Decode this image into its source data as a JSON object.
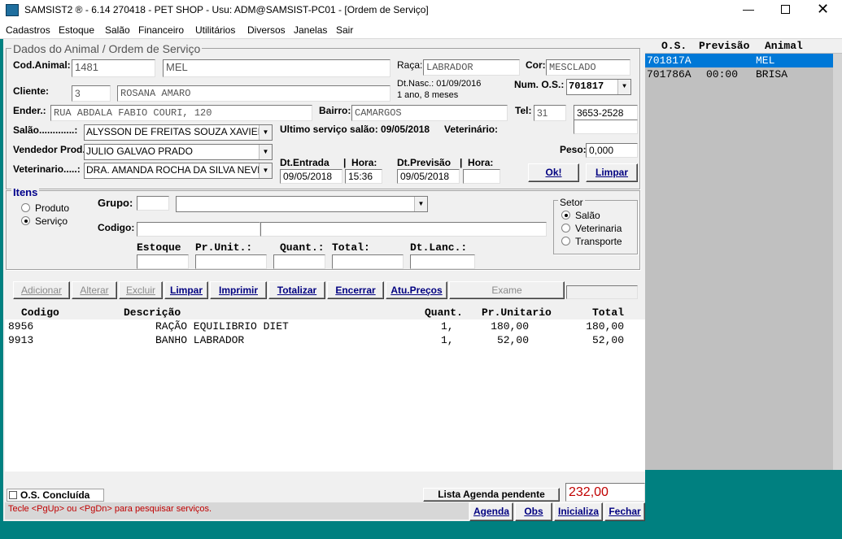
{
  "window": {
    "title": "SAMSIST2 ® - 6.14  270418 - PET SHOP - Usu: ADM@SAMSIST-PC01 - [Ordem de Serviço]"
  },
  "menu": [
    "Cadastros",
    "Estoque",
    "Salão",
    "Financeiro",
    "Utilitários",
    "Diversos",
    "Janelas",
    "Sair"
  ],
  "section_title": "Dados do Animal / Ordem de Serviço",
  "animal": {
    "cod_label": "Cod.Animal:",
    "cod": "1481",
    "nome": "MEL",
    "raca_label": "Raça:",
    "raca": "LABRADOR",
    "cor_label": "Cor:",
    "cor": "MESCLADO",
    "cliente_label": "Cliente:",
    "cliente_cod": "3",
    "cliente_nome": "ROSANA AMARO",
    "dtnasc": "Dt.Nasc.: 01/09/2016",
    "idade": "1 ano,  8 meses",
    "numos_label": "Num. O.S.:",
    "numos": "701817",
    "ender_label": "Ender.:",
    "ender": "RUA ABDALA FABIO COURI, 120",
    "bairro_label": "Bairro:",
    "bairro": "CAMARGOS",
    "tel_label": "Tel:",
    "tel_ddd": "31",
    "tel": "3653-2528",
    "salao_label": "Salão.............:",
    "salao": "ALYSSON DE FREITAS SOUZA XAVIER",
    "ultimo_servico": "Ultimo serviço salão: 09/05/2018",
    "veterinario_label": "Veterinário:",
    "vendedor_label": "Vendedor Prod.",
    "vendedor": "JULIO GALVAO PRADO",
    "peso_label": "Peso:",
    "peso": "0,000",
    "vet_label": "Veterinario.....:",
    "vet": "DRA. AMANDA ROCHA DA SILVA NEVES",
    "dtentrada_label": "Dt.Entrada",
    "hora_label": "Hora:",
    "dtentrada": "09/05/2018",
    "hora_entrada": "15:36",
    "dtprevisao_label": "Dt.Previsão",
    "dtprevisao": "09/05/2018",
    "hora_previsao": "",
    "ok_button": "Ok!",
    "limpar_button": "Limpar"
  },
  "itens": {
    "title": "Itens",
    "produto": "Produto",
    "servico": "Serviço",
    "grupo_label": "Grupo:",
    "codigo_label": "Codigo:",
    "estoque_label": "Estoque",
    "prunit_label": "Pr.Unit.:",
    "quant_label": "Quant.:",
    "total_label": "Total:",
    "dtlanc_label": "Dt.Lanc.:",
    "setor_title": "Setor",
    "setor_salao": "Salão",
    "setor_vet": "Veterinaria",
    "setor_transp": "Transporte"
  },
  "actions": [
    "Adicionar",
    "Alterar",
    "Excluir",
    "Limpar",
    "Imprimir",
    "Totalizar",
    "Encerrar",
    "Atu.Preços",
    "Exame"
  ],
  "grid": {
    "headers": [
      "Codigo",
      "Descrição",
      "Quant.",
      "Pr.Unitario",
      "Total"
    ],
    "rows": [
      [
        "8956",
        "RAÇÃO EQUILIBRIO DIET",
        "1,",
        "180,00",
        "180,00"
      ],
      [
        "9913",
        "BANHO LABRADOR",
        "1,",
        "52,00",
        "52,00"
      ]
    ]
  },
  "os_list": {
    "headers": [
      "O.S.",
      "Previsão",
      "Animal"
    ],
    "rows": [
      [
        "701817A",
        "",
        "MEL"
      ],
      [
        "701786A",
        "00:00",
        "BRISA"
      ]
    ]
  },
  "bottom": {
    "concluida": "O.S. Concluída",
    "agenda_pendente": "Lista Agenda pendente",
    "total": "232,00",
    "hint": "Tecle <PgUp> ou <PgDn> para pesquisar serviços.",
    "agenda": "Agenda",
    "obs": "Obs",
    "inicializa": "Inicializa",
    "fechar": "Fechar"
  },
  "colors": {
    "accent": "#0078d7",
    "teal": "#008080",
    "total_red": "#c00000"
  }
}
